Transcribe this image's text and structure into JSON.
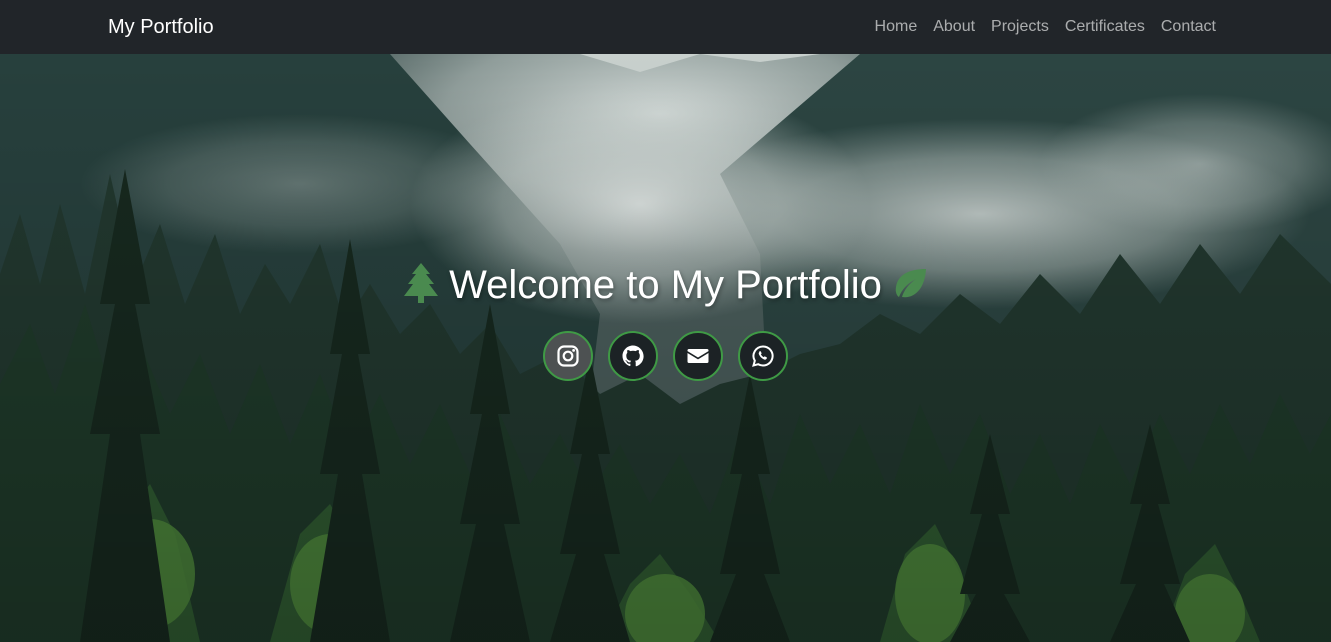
{
  "navbar": {
    "brand": "My Portfolio",
    "links": [
      {
        "label": "Home"
      },
      {
        "label": "About"
      },
      {
        "label": "Projects"
      },
      {
        "label": "Certificates"
      },
      {
        "label": "Contact"
      }
    ]
  },
  "hero": {
    "title": "Welcome to My Portfolio",
    "left_icon": "tree-icon",
    "right_icon": "leaf-icon",
    "social_links": [
      {
        "icon": "instagram-icon"
      },
      {
        "icon": "github-icon"
      },
      {
        "icon": "envelope-icon"
      },
      {
        "icon": "whatsapp-icon"
      }
    ]
  },
  "colors": {
    "navbar_bg": "#212529",
    "accent_green": "#3f9a45",
    "icon_green": "#4a8a4f",
    "text": "#ffffff"
  }
}
